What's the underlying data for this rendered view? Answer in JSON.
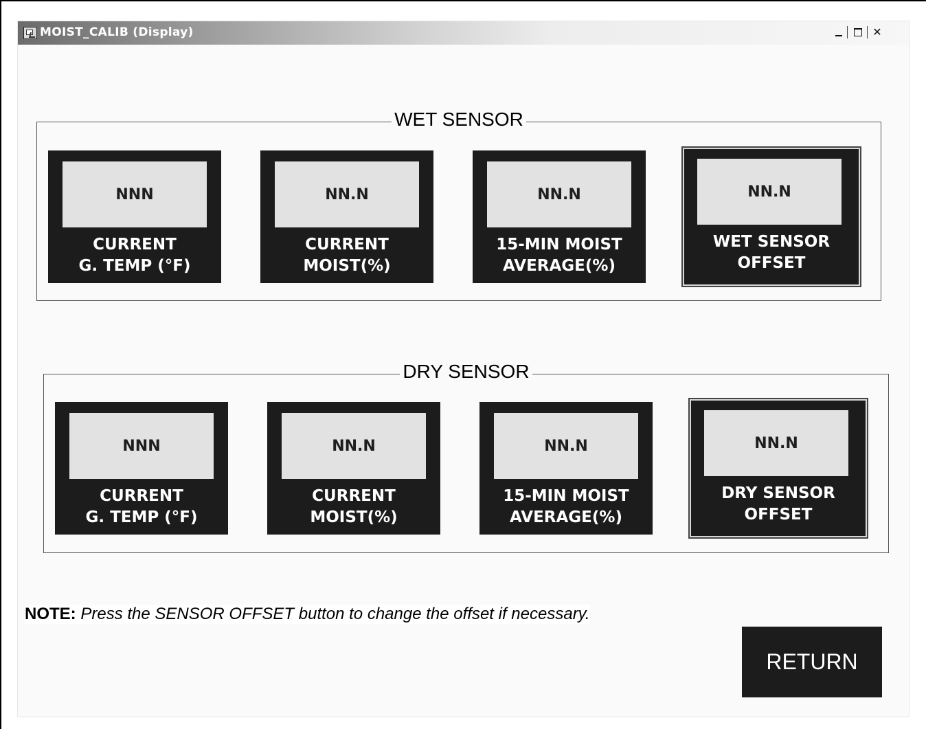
{
  "window": {
    "title": "MOIST_CALIB (Display)",
    "controls": [
      "minimize-icon",
      "maximize-icon",
      "close-icon"
    ]
  },
  "wet_sensor": {
    "title": "WET SENSOR",
    "tiles": [
      {
        "value": "NNN",
        "label": "CURRENT\nG. TEMP (°F)"
      },
      {
        "value": "NN.N",
        "label": "CURRENT\nMOIST(%)"
      },
      {
        "value": "NN.N",
        "label": "15-MIN MOIST\nAVERAGE(%)"
      },
      {
        "value": "NN.N",
        "label": "WET SENSOR\nOFFSET"
      }
    ]
  },
  "dry_sensor": {
    "title": "DRY SENSOR",
    "tiles": [
      {
        "value": "NNN",
        "label": "CURRENT\nG. TEMP (°F)"
      },
      {
        "value": "NN.N",
        "label": "CURRENT\nMOIST(%)"
      },
      {
        "value": "NN.N",
        "label": "15-MIN MOIST\nAVERAGE(%)"
      },
      {
        "value": "NN.N",
        "label": "DRY SENSOR\nOFFSET"
      }
    ]
  },
  "note": {
    "prefix": "NOTE:",
    "text": "Press the SENSOR OFFSET button to change the offset if necessary."
  },
  "return_button": {
    "label": "RETURN"
  },
  "colors": {
    "tile_bg": "#1c1c1c",
    "display_bg": "#e2e2e2"
  }
}
